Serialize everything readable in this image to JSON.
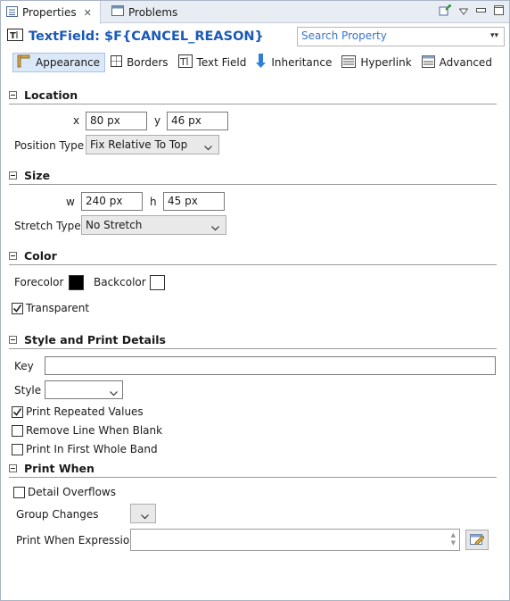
{
  "tabs": [
    {
      "label": "Properties",
      "icon": "properties-icon",
      "active": true
    },
    {
      "label": "Problems",
      "icon": "problems-icon",
      "active": false
    }
  ],
  "header": {
    "title": "TextField: $F{CANCEL_REASON}",
    "search_placeholder": "Search Property"
  },
  "sections": [
    {
      "label": "Appearance",
      "icon": "appearance-icon",
      "selected": true
    },
    {
      "label": "Borders",
      "icon": "borders-icon"
    },
    {
      "label": "Text Field",
      "icon": "textfield-icon"
    },
    {
      "label": "Inheritance",
      "icon": "inheritance-icon"
    },
    {
      "label": "Hyperlink",
      "icon": "hyperlink-icon"
    },
    {
      "label": "Advanced",
      "icon": "advanced-icon"
    }
  ],
  "location": {
    "heading": "Location",
    "x_label": "x",
    "x_value": "80 px",
    "y_label": "y",
    "y_value": "46 px",
    "position_type_label": "Position Type",
    "position_type_value": "Fix Relative To Top"
  },
  "size": {
    "heading": "Size",
    "w_label": "w",
    "w_value": "240 px",
    "h_label": "h",
    "h_value": "45 px",
    "stretch_type_label": "Stretch Type",
    "stretch_type_value": "No Stretch"
  },
  "color": {
    "heading": "Color",
    "forecolor_label": "Forecolor",
    "forecolor": "#000000",
    "backcolor_label": "Backcolor",
    "backcolor": "#ffffff",
    "transparent_label": "Transparent",
    "transparent": true
  },
  "style_print": {
    "heading": "Style and Print Details",
    "key_label": "Key",
    "key_value": "",
    "style_label": "Style",
    "style_value": "",
    "print_repeated_label": "Print Repeated Values",
    "print_repeated": true,
    "remove_line_label": "Remove Line When Blank",
    "remove_line": false,
    "print_first_label": "Print In First Whole Band",
    "print_first": false
  },
  "print_when": {
    "heading": "Print When",
    "detail_overflows_label": "Detail Overflows",
    "detail_overflows": false,
    "group_changes_label": "Group Changes",
    "group_changes_value": "",
    "expression_label": "Print When Expression",
    "expression_value": ""
  },
  "colors": {
    "accent": "#1a59b8",
    "tabbar": "#e8edf3",
    "selected_section": "#dbe8f8"
  }
}
